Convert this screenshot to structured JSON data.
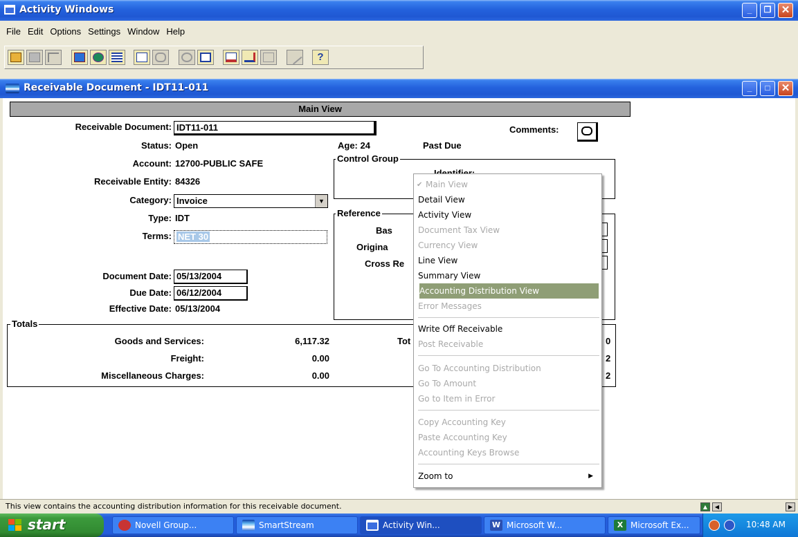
{
  "app": {
    "title": "Activity Windows",
    "menu": [
      "File",
      "Edit",
      "Options",
      "Settings",
      "Window",
      "Help"
    ]
  },
  "toolbar": {
    "buttons": [
      "open-folder-icon",
      "save-icon",
      "blank-icon",
      "transfer-icon",
      "globe-icon",
      "list-icon",
      "edit-icon",
      "attach-icon",
      "find-icon",
      "notes-icon",
      "report-icon",
      "import-icon",
      "export-icon",
      "pencil-icon",
      "help-icon"
    ]
  },
  "document_window": {
    "title": "Receivable Document  -  IDT11-011",
    "view_bar": "Main View",
    "fields": {
      "receivable_document_label": "Receivable Document:",
      "receivable_document_value": "IDT11-011",
      "status_label": "Status:",
      "status_value": "Open",
      "account_label": "Account:",
      "account_value": "12700-PUBLIC SAFE",
      "entity_label": "Receivable Entity:",
      "entity_value": "84326",
      "category_label": "Category:",
      "category_value": "Invoice",
      "type_label": "Type:",
      "type_value": "IDT",
      "terms_label": "Terms:",
      "terms_value": "NET 30",
      "document_date_label": "Document Date:",
      "document_date_value": "05/13/2004",
      "due_date_label": "Due Date:",
      "due_date_value": "06/12/2004",
      "effective_date_label": "Effective Date:",
      "effective_date_value": "05/13/2004",
      "age_text": "Age: 24",
      "past_due": "Past Due",
      "comments_label": "Comments:"
    },
    "control_group": {
      "title": "Control Group",
      "identifier_label": "Identifier:"
    },
    "reference": {
      "title": "Reference",
      "labels": [
        "Bas",
        "Origina",
        "Cross Re"
      ]
    },
    "totals": {
      "title": "Totals",
      "rows": [
        {
          "label": "Goods and Services:",
          "value": "6,117.32"
        },
        {
          "label": "Freight:",
          "value": "0.00"
        },
        {
          "label": "Miscellaneous Charges:",
          "value": "0.00"
        }
      ],
      "right_label_partial": "Tot",
      "right_values_partial": [
        "0",
        "2",
        "2"
      ]
    }
  },
  "context_menu": {
    "items": [
      {
        "label": "Main View",
        "state": "checked-disabled"
      },
      {
        "label": "Detail View",
        "state": "enabled"
      },
      {
        "label": "Activity View",
        "state": "enabled"
      },
      {
        "label": "Document Tax View",
        "state": "disabled"
      },
      {
        "label": "Currency View",
        "state": "disabled"
      },
      {
        "label": "Line View",
        "state": "enabled"
      },
      {
        "label": "Summary View",
        "state": "enabled"
      },
      {
        "label": "Accounting Distribution View",
        "state": "highlighted"
      },
      {
        "label": "Error Messages",
        "state": "disabled"
      },
      {
        "label": "Write Off Receivable",
        "state": "enabled"
      },
      {
        "label": "Post Receivable",
        "state": "disabled"
      },
      {
        "label": "Go To Accounting Distribution",
        "state": "disabled"
      },
      {
        "label": "Go To Amount",
        "state": "disabled"
      },
      {
        "label": "Go to Item in Error",
        "state": "disabled"
      },
      {
        "label": "Copy Accounting Key",
        "state": "disabled"
      },
      {
        "label": "Paste Accounting Key",
        "state": "disabled"
      },
      {
        "label": "Accounting Keys Browse",
        "state": "disabled"
      },
      {
        "label": "Zoom to",
        "state": "submenu"
      }
    ]
  },
  "statusbar": {
    "text": "This view contains the accounting distribution information for this receivable document."
  },
  "taskbar": {
    "start": "start",
    "tasks": [
      {
        "label": "Novell Group...",
        "icon": "novell-icon"
      },
      {
        "label": "SmartStream",
        "icon": "smartstream-icon"
      },
      {
        "label": "Activity Win...",
        "icon": "window-icon",
        "active": true
      },
      {
        "label": "Microsoft W...",
        "icon": "word-icon"
      },
      {
        "label": "Microsoft Ex...",
        "icon": "excel-icon"
      }
    ],
    "clock": "10:48 AM"
  },
  "colors": {
    "title_blue": "#245edc",
    "menu_highlight": "#8f9e76",
    "disabled_text": "#a9a9a9",
    "start_green": "#3c9a3c"
  }
}
